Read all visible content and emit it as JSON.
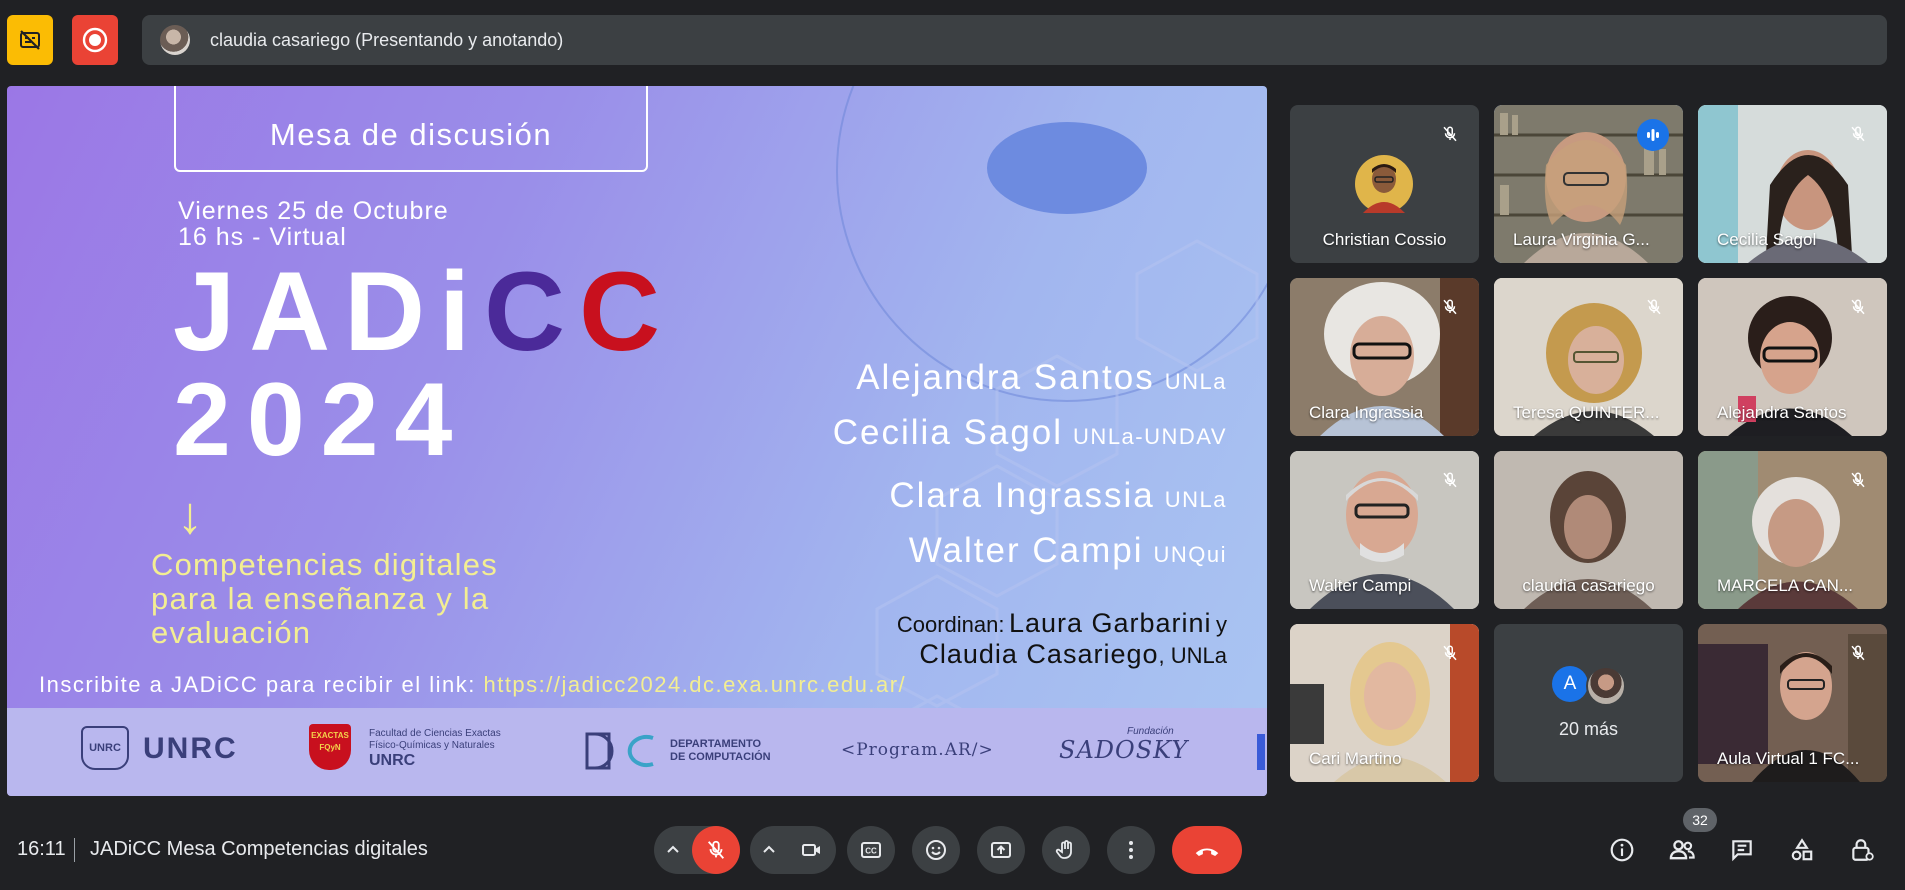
{
  "top_bar": {
    "presenter_text": "claudia casariego (Presentando y anotando)"
  },
  "slide": {
    "box_title": "Mesa de discusión",
    "date_line1": "Viernes 25 de Octubre",
    "date_line2": "16 hs - Virtual",
    "event_part1": "JADi",
    "event_part2": "C",
    "event_part3": "C",
    "year": "2024",
    "speakers": [
      {
        "name": "Alejandra Santos",
        "org": "UNLa"
      },
      {
        "name": "Cecilia Sagol",
        "org": "UNLa-UNDAV"
      },
      {
        "name": "Clara Ingrassia",
        "org": "UNLa"
      },
      {
        "name": "Walter Campi",
        "org": "UNQui"
      }
    ],
    "topic_line1": "Competencias digitales",
    "topic_line2": "para la enseñanza y la",
    "topic_line3": "evaluación",
    "coord_label": "Coordinan:",
    "coord_name1": "Laura Garbarini",
    "coord_y": "y",
    "coord_name2": "Claudia Casariego",
    "coord_org": ", UNLa",
    "signup_text": "Inscribite a JADiCC para recibir el link:",
    "signup_link": "https://jadicc2024.dc.exa.unrc.edu.ar/",
    "logos": {
      "unrc_small": "UNRC",
      "unrc": "UNRC",
      "exactas_badge": "EXACTAS",
      "exactas_badge2": "FQyN",
      "facultad_line1": "Facultad de Ciencias Exactas",
      "facultad_line2": "Físico-Químicas y Naturales",
      "facultad_line3": "UNRC",
      "dc_line1": "DEPARTAMENTO",
      "dc_line2": "DE COMPUTACIÓN",
      "program_ar": "<Program.AR/>",
      "fundacion": "Fundación",
      "sadosky": "SADOSKY"
    }
  },
  "participants": [
    {
      "name": "Christian Cossio"
    },
    {
      "name": "Laura Virginia G..."
    },
    {
      "name": "Cecilia Sagol"
    },
    {
      "name": "Clara Ingrassia"
    },
    {
      "name": "Teresa QUINTER..."
    },
    {
      "name": "Alejandra Santos"
    },
    {
      "name": "Walter Campi"
    },
    {
      "name": "claudia casariego"
    },
    {
      "name": "MARCELA CAN..."
    },
    {
      "name": "Cari Martino"
    },
    {
      "name": "20 más",
      "avatar_letter": "A"
    },
    {
      "name": "Aula Virtual 1 FC..."
    }
  ],
  "bottom_bar": {
    "time": "16:11",
    "meeting_name": "JADiCC Mesa Competencias digitales",
    "participant_count": "32"
  },
  "colors": {
    "background": "#202124",
    "surface": "#3c4043",
    "danger": "#ea4335",
    "warning": "#fbbc04",
    "accent": "#8ab4f8",
    "slide_yellow": "#f3ee92"
  },
  "icons": [
    "captions-off-icon",
    "record-icon",
    "mic-off-icon",
    "speaking-icon",
    "chevron-up-icon",
    "camera-icon",
    "cc-icon",
    "emoji-icon",
    "present-icon",
    "raise-hand-icon",
    "more-vert-icon",
    "end-call-icon",
    "info-icon",
    "people-icon",
    "chat-icon",
    "activities-icon",
    "host-controls-icon"
  ]
}
